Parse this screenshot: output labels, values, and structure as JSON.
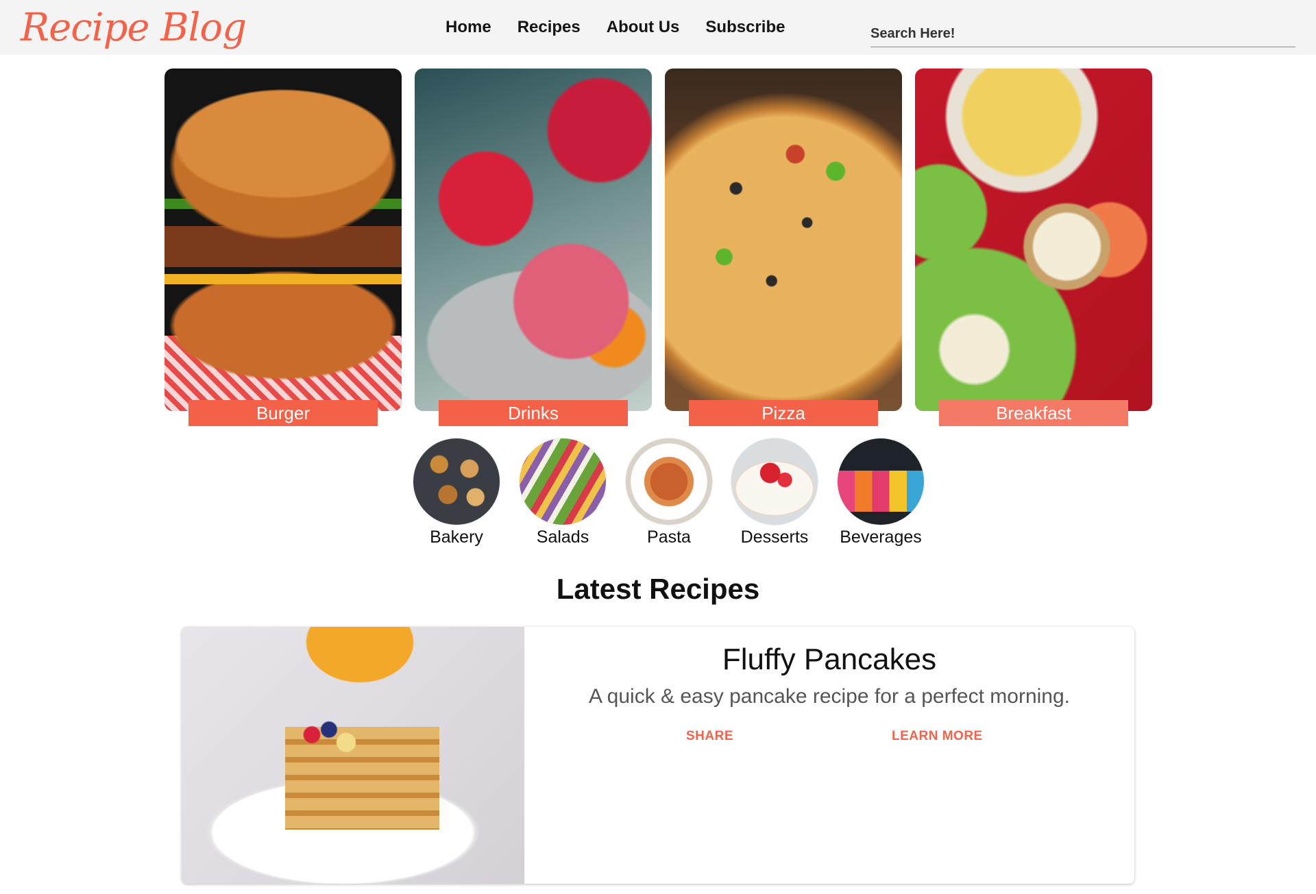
{
  "header": {
    "logo": "Recipe Blog",
    "nav": [
      "Home",
      "Recipes",
      "About Us",
      "Subscribe"
    ],
    "search_placeholder": "Search Here!"
  },
  "categories": [
    {
      "label": "Burger",
      "image": "burger-photo"
    },
    {
      "label": "Drinks",
      "image": "drinks-photo"
    },
    {
      "label": "Pizza",
      "image": "pizza-photo"
    },
    {
      "label": "Breakfast",
      "image": "breakfast-photo"
    }
  ],
  "subcategories": [
    {
      "label": "Bakery",
      "image": "bakery-photo"
    },
    {
      "label": "Salads",
      "image": "salads-photo"
    },
    {
      "label": "Pasta",
      "image": "pasta-photo"
    },
    {
      "label": "Desserts",
      "image": "desserts-photo"
    },
    {
      "label": "Beverages",
      "image": "beverages-photo"
    }
  ],
  "latest": {
    "title": "Latest Recipes",
    "recipe": {
      "name": "Fluffy Pancakes",
      "description": "A quick & easy pancake recipe for a perfect morning.",
      "share_label": "SHARE",
      "learn_more_label": "LEARN MORE",
      "image": "pancakes-photo"
    }
  },
  "colors": {
    "accent": "#f2634a",
    "header_bg": "#f4f4f4"
  }
}
